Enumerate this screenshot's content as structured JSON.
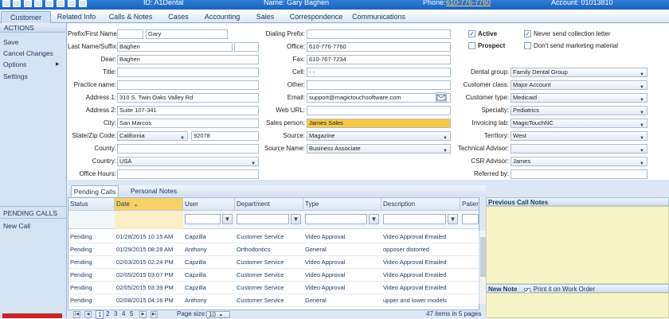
{
  "topbar": {
    "id_label": "ID: A1Dental",
    "name_label": "Name: Gary Baghen",
    "phone_label": "Phone:",
    "phone_value": "610-776-7760",
    "account_label": "Account: 01013810"
  },
  "tabs": [
    "Customer",
    "Related Info",
    "Calls & Notes",
    "Cases",
    "Accounting",
    "Sales",
    "Correspondence",
    "Communications"
  ],
  "left": {
    "actions_header": "ACTIONS",
    "actions": [
      "Save",
      "Cancel Changes",
      "Options",
      "Settings"
    ],
    "options_arrow": "▶",
    "pending_header": "PENDING CALLS",
    "pending_items": [
      "New Call"
    ]
  },
  "form": {
    "prefix_label": "Prefix/First Name:",
    "prefix_value": "",
    "first_name": "Gary",
    "last_label": "Last Name/Suffix:",
    "last_name": "Baghen",
    "suffix": "",
    "dear_label": "Dear:",
    "dear_value": "Baghen",
    "title_label": "Title:",
    "title_value": "",
    "practice_label": "Practice name:",
    "practice_value": "",
    "address1_label": "Address 1:",
    "address1_value": "310 S. Twin Oaks Valley Rd",
    "address2_label": "Address 2:",
    "address2_value": "Suite 107-341",
    "city_label": "City:",
    "city_value": "San Marcos",
    "state_label": "State/Zip Code:",
    "state_value": "California",
    "zip_value": "92078",
    "county_label": "County:",
    "county_value": "",
    "country_label": "Country:",
    "country_value": "USA",
    "office_hours_label": "Office Hours:",
    "office_hours_value": "",
    "dialing_prefix_label": "Dialing Prefix:",
    "dialing_prefix_value": "",
    "office_label": "Office:",
    "office_value": "610-776-7760",
    "fax_label": "Fax:",
    "fax_value": "610-767-7234",
    "cell_label": "Cell:",
    "cell_value": "-  -",
    "other_label": "Other:",
    "other_value": "",
    "email_label": "Email:",
    "email_value": "support@magictouchsoftware.com",
    "web_label": "Web URL:",
    "web_value": "",
    "salesperson_label": "Sales person:",
    "salesperson_value": "James Sales",
    "source_label": "Source:",
    "source_value": "Magazine",
    "source_name_label": "Source Name:",
    "source_name_value": "Business Associate",
    "active_label": "Active",
    "prospect_label": "Prospect",
    "never_collect_label": "Never send collection letter",
    "no_marketing_label": "Don't send marketing material",
    "check_mark": "✓",
    "dental_group_label": "Dental group:",
    "dental_group_value": "Family Dental Group",
    "customer_class_label": "Customer class:",
    "customer_class_value": "Major Account",
    "customer_type_label": "Customer type:",
    "customer_type_value": "Medicaid",
    "specialty_label": "Specialty:",
    "specialty_value": "Pediatrics",
    "invoicing_lab_label": "Invoicing lab:",
    "invoicing_lab_value": "MagicTouchNC",
    "territory_label": "Territory:",
    "territory_value": "West",
    "tech_advisor_label": "Technical Advisor:",
    "tech_advisor_value": "",
    "csr_advisor_label": "CSR Advisor:",
    "csr_advisor_value": "James",
    "referred_label": "Referred by:",
    "referred_value": ""
  },
  "subtabs": [
    "Pending Calls",
    "Personal Notes"
  ],
  "grid": {
    "headers": [
      "Status",
      "Date",
      "User",
      "Department",
      "Type",
      "Description",
      "Patient"
    ],
    "sort_indicator": "▲",
    "filter_icon": "▼",
    "rows": [
      [
        "Pending",
        "01/28/2015 10:15 AM",
        "Capzilla",
        "Customer Service",
        "Video Approval",
        "Video Approval Emailed"
      ],
      [
        "Pending",
        "01/29/2015 08:28 AM",
        "Anthony",
        "Orthodontics",
        "General",
        "opposer distorted"
      ],
      [
        "Pending",
        "02/03/2015 02:24 PM",
        "Capzilla",
        "Customer Service",
        "Video Approval",
        "Video Approval Emailed"
      ],
      [
        "Pending",
        "02/05/2015 03:07 PM",
        "Capzilla",
        "Customer Service",
        "Video Approval",
        "Video Approval Emailed"
      ],
      [
        "Pending",
        "02/05/2015 03:39 PM",
        "Capzilla",
        "Customer Service",
        "Video Approval",
        "Video Approval Emailed"
      ],
      [
        "Pending",
        "02/08/2015 04:16 PM",
        "Anthony",
        "Customer Service",
        "General",
        "upper and lower models"
      ]
    ]
  },
  "pager": {
    "pages": [
      "1",
      "2",
      "3",
      "4",
      "5"
    ],
    "page_size_label": "Page size:",
    "page_size_value": "10",
    "items_text": "47 items in 5 pages"
  },
  "right": {
    "prev_notes_label": "Previous Call Notes",
    "new_note_label": "New Note",
    "print_label": "Print it on Work Order"
  },
  "colors": {
    "accent": "#1b62bb",
    "sorted_header": "#f7d068",
    "salesperson_highlight": "#f7c94a",
    "notes_background": "#f7f3c9"
  }
}
